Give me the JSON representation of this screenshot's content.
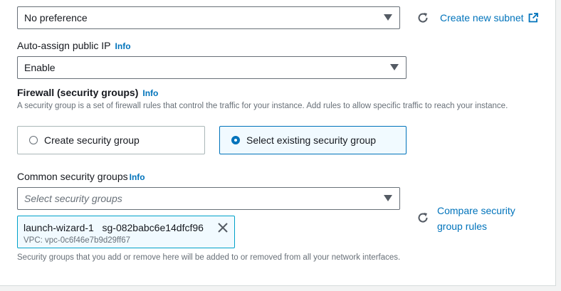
{
  "subnet": {
    "value": "No preference",
    "create_link": "Create new subnet"
  },
  "auto_assign_ip": {
    "label": "Auto-assign public IP",
    "info": "Info",
    "value": "Enable"
  },
  "firewall": {
    "label": "Firewall (security groups)",
    "info": "Info",
    "description": "A security group is a set of firewall rules that control the traffic for your instance. Add rules to allow specific traffic to reach your instance.",
    "options": [
      {
        "label": "Create security group",
        "selected": false
      },
      {
        "label": "Select existing security group",
        "selected": true
      }
    ]
  },
  "common_groups": {
    "label": "Common security groups",
    "info": "Info",
    "placeholder": "Select security groups",
    "compare_link_line1": "Compare security",
    "compare_link_line2": "group rules",
    "token": {
      "name": "launch-wizard-1   sg-082babc6e14dfcf96",
      "vpc": "VPC: vpc-0c6f46e7b9d29ff67"
    },
    "footnote": "Security groups that you add or remove here will be added to or removed from all your network interfaces."
  },
  "colors": {
    "link": "#0073bb",
    "selected_border": "#0073bb",
    "token_border": "#00a1c9"
  },
  "icons": [
    "refresh-icon",
    "external-link-icon",
    "caret-down-icon",
    "close-icon"
  ]
}
